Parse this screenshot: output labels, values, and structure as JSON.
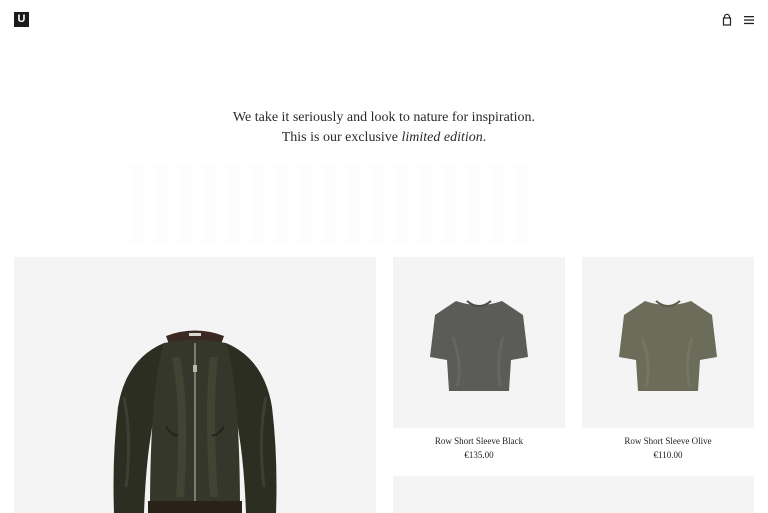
{
  "header": {
    "logo_text": "U",
    "icons": [
      "shopping-bag-icon",
      "hamburger-menu-icon"
    ]
  },
  "hero": {
    "line1": "We take it seriously and look to nature for inspiration.",
    "line2_prefix": "This is our exclusive ",
    "line2_emphasis": "limited edition",
    "line2_suffix": "."
  },
  "products": [
    {
      "name": "Row Short Sleeve Black",
      "price": "€135.00",
      "color": "#5b5b57"
    },
    {
      "name": "Row Short Sleeve Olive",
      "price": "€110.00",
      "color": "#6c6c5a"
    }
  ],
  "featured": {
    "item": "bomber-jacket",
    "color": "#2f3124"
  }
}
